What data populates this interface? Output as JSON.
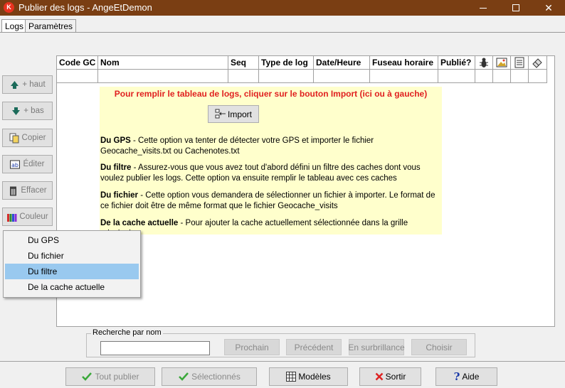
{
  "window": {
    "icon_letter": "K",
    "title": "Publier des logs - AngeEtDemon",
    "controls": {
      "minimize": "",
      "maximize": "",
      "close": "✕"
    }
  },
  "tabs": [
    {
      "label": "Logs",
      "active": true
    },
    {
      "label": "Paramètres",
      "active": false
    }
  ],
  "sidebar": {
    "up": "+ haut",
    "down": "+ bas",
    "copy": "Copier",
    "edit": "Éditer",
    "delete": "Effacer",
    "color": "Couleur"
  },
  "grid": {
    "columns": [
      "Code GC",
      "Nom",
      "Seq",
      "Type de log",
      "Date/Heure",
      "Fuseau horaire",
      "Publié?"
    ],
    "icon_columns": [
      "bug-icon",
      "image-icon",
      "notepad-icon",
      "eraser-icon"
    ]
  },
  "info": {
    "title": "Pour remplir le tableau de logs, cliquer sur le bouton Import (ici ou à gauche)",
    "import_label": "Import",
    "gps_bold": "Du GPS",
    "gps_text": " - Cette option va tenter de détecter votre GPS et importer le fichier Geocache_visits.txt ou Cachenotes.txt",
    "filter_bold": "Du filtre",
    "filter_text": " - Assurez-vous que vous avez tout d'abord défini un filtre des caches dont vous voulez publier les logs. Cette option va ensuite remplir le tableau avec ces caches",
    "file_bold": "Du fichier",
    "file_text": " - Cette option vous demandera de sélectionner un fichier à importer. Le format de ce fichier doit être de même format que le fichier Geocache_visits",
    "current_bold": "De la cache actuelle",
    "current_text": " - Pour ajouter la cache actuellement sélectionnée dans la grille principale"
  },
  "menu": {
    "items": [
      "Du GPS",
      "Du fichier",
      "Du filtre",
      "De la cache actuelle"
    ],
    "highlighted": "Du filtre"
  },
  "search": {
    "legend": "Recherche par nom",
    "value": "",
    "next": "Prochain",
    "previous": "Précédent",
    "highlight": "En surbrillance",
    "choose": "Choisir"
  },
  "footer": {
    "publish_all": "Tout publier",
    "selected": "Sélectionnés",
    "templates": "Modèles",
    "exit": "Sortir",
    "help": "Aide"
  },
  "colors": {
    "titlebar": "#7a3e13",
    "info_background": "#ffffcc",
    "info_title": "#e02020",
    "menu_highlight": "#99c9ef"
  }
}
